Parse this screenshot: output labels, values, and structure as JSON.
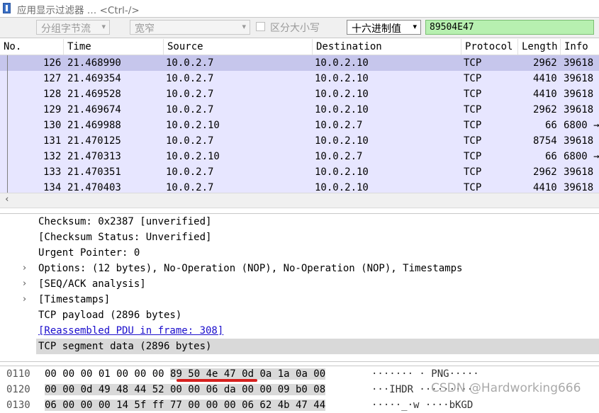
{
  "filter": {
    "placeholder": "应用显示过滤器 … <Ctrl-/>"
  },
  "search": {
    "scope_label": "分组字节流",
    "width_label": "宽窄",
    "case_label": "区分大小写",
    "type_label": "十六进制值",
    "value": "89504E47"
  },
  "columns": [
    "No.",
    "Time",
    "Source",
    "Destination",
    "Protocol",
    "Length",
    "Info"
  ],
  "packets": [
    {
      "no": "126",
      "time": "21.468990",
      "src": "10.0.2.7",
      "dst": "10.0.2.10",
      "proto": "TCP",
      "len": "2962",
      "info": "39618"
    },
    {
      "no": "127",
      "time": "21.469354",
      "src": "10.0.2.7",
      "dst": "10.0.2.10",
      "proto": "TCP",
      "len": "4410",
      "info": "39618"
    },
    {
      "no": "128",
      "time": "21.469528",
      "src": "10.0.2.7",
      "dst": "10.0.2.10",
      "proto": "TCP",
      "len": "4410",
      "info": "39618"
    },
    {
      "no": "129",
      "time": "21.469674",
      "src": "10.0.2.7",
      "dst": "10.0.2.10",
      "proto": "TCP",
      "len": "2962",
      "info": "39618"
    },
    {
      "no": "130",
      "time": "21.469988",
      "src": "10.0.2.10",
      "dst": "10.0.2.7",
      "proto": "TCP",
      "len": "66",
      "info": "6800 →"
    },
    {
      "no": "131",
      "time": "21.470125",
      "src": "10.0.2.7",
      "dst": "10.0.2.10",
      "proto": "TCP",
      "len": "8754",
      "info": "39618"
    },
    {
      "no": "132",
      "time": "21.470313",
      "src": "10.0.2.10",
      "dst": "10.0.2.7",
      "proto": "TCP",
      "len": "66",
      "info": "6800 →"
    },
    {
      "no": "133",
      "time": "21.470351",
      "src": "10.0.2.7",
      "dst": "10.0.2.10",
      "proto": "TCP",
      "len": "2962",
      "info": "39618"
    },
    {
      "no": "134",
      "time": "21.470403",
      "src": "10.0.2.7",
      "dst": "10.0.2.10",
      "proto": "TCP",
      "len": "4410",
      "info": "39618"
    }
  ],
  "details": [
    {
      "text": "Checksum: 0x2387 [unverified]",
      "expandable": false
    },
    {
      "text": "[Checksum Status: Unverified]",
      "expandable": false
    },
    {
      "text": "Urgent Pointer: 0",
      "expandable": false
    },
    {
      "text": "Options: (12 bytes), No-Operation (NOP), No-Operation (NOP), Timestamps",
      "expandable": true
    },
    {
      "text": "[SEQ/ACK analysis]",
      "expandable": true
    },
    {
      "text": "[Timestamps]",
      "expandable": true
    },
    {
      "text": "TCP payload (2896 bytes)",
      "expandable": false
    },
    {
      "text": "[Reassembled PDU in frame: 308]",
      "expandable": false,
      "link": true
    },
    {
      "text": "TCP segment data (2896 bytes)",
      "expandable": false,
      "selected": true
    }
  ],
  "bytes": [
    {
      "offset": "0110",
      "hex_pre": "00 00 00 01 00 00 00",
      "hex_sel": "89  50 4e 47 0d 0a 1a 0a 00",
      "ascii": "·······  · PNG·····"
    },
    {
      "offset": "0120",
      "hex_pre": "",
      "hex_sel": "00 00 0d 49 48 44 52  00 00 06 da 00 00 09 b0 08",
      "ascii": "···IHDR ·········"
    },
    {
      "offset": "0130",
      "hex_pre": "",
      "hex_sel": "06 00 00 00 14 5f ff 77  00 00 00 06 62 4b 47 44",
      "ascii": "·····_·w ····bKGD"
    }
  ],
  "watermark": "CSDN @Hardworking666"
}
